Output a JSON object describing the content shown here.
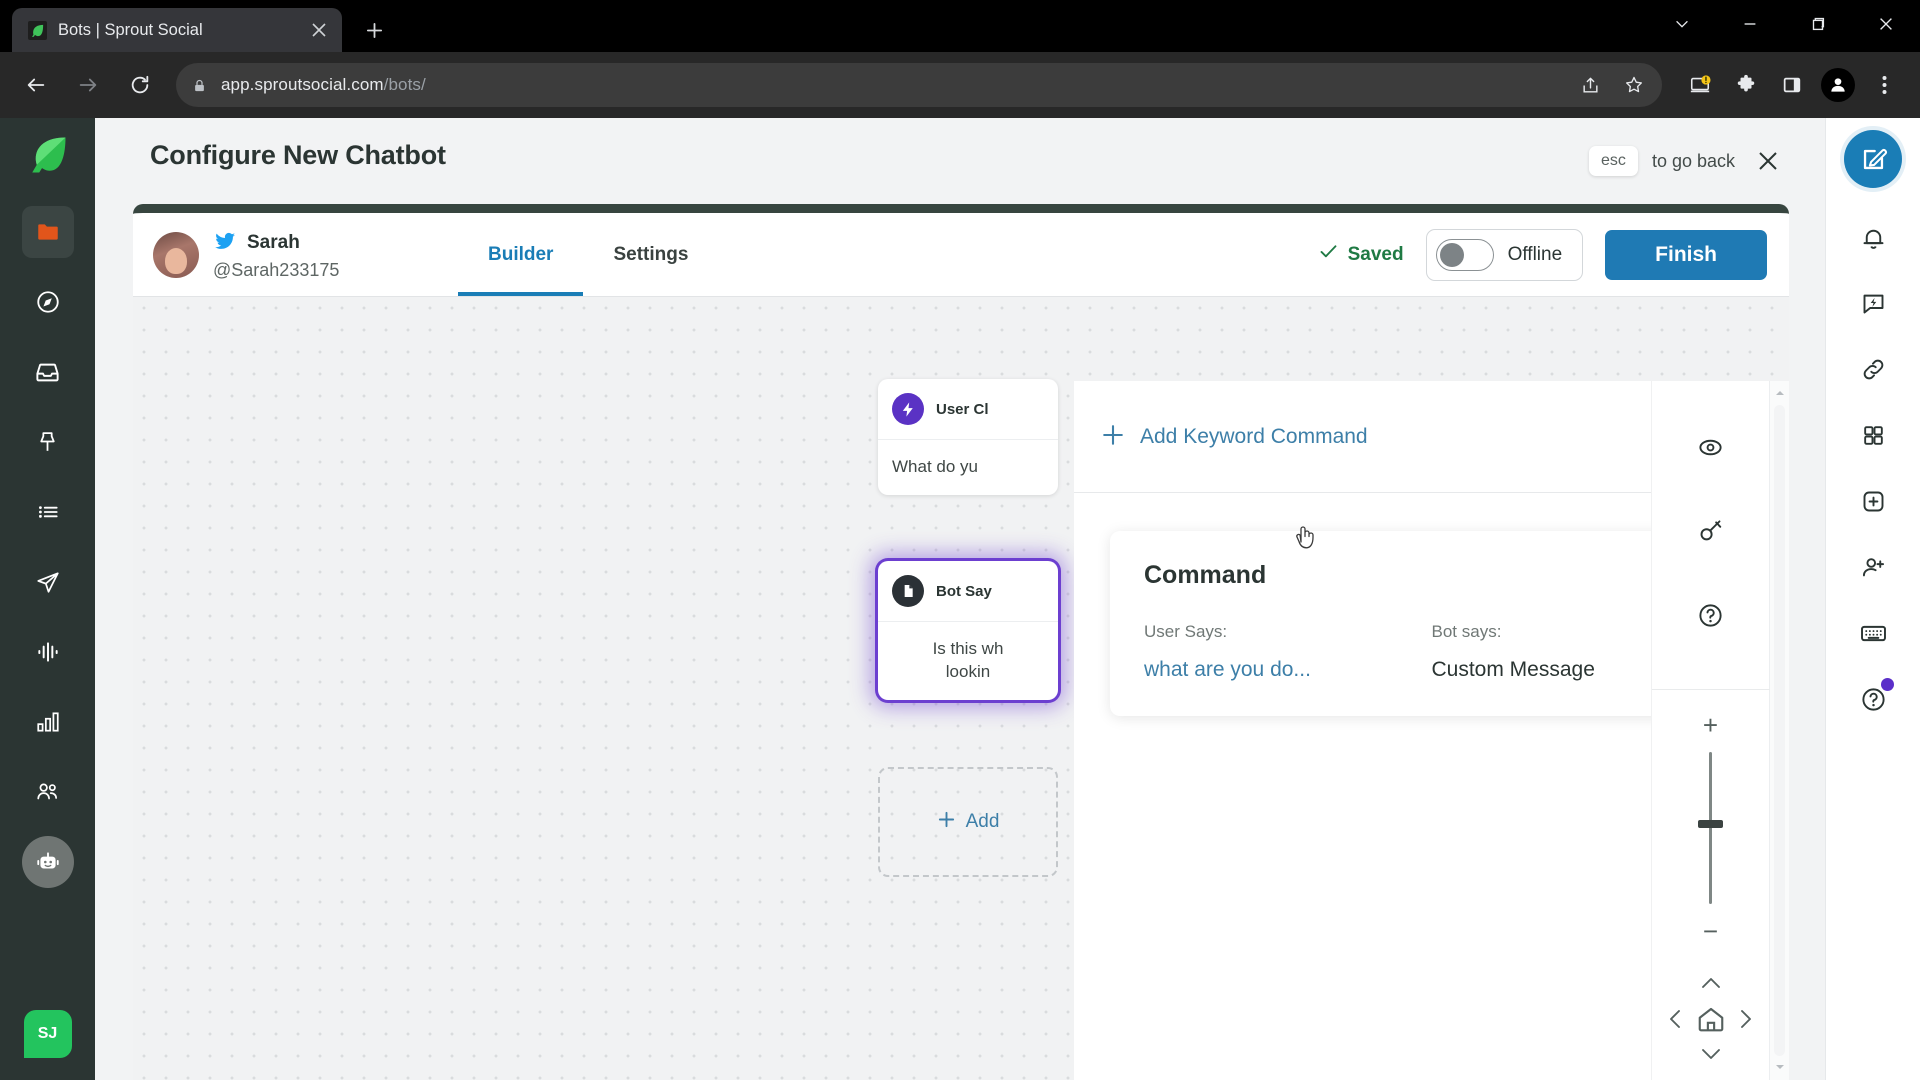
{
  "browser": {
    "tab": {
      "title": "Bots | Sprout Social",
      "favicon_icon": "sprout-leaf-icon",
      "close_icon": "close-icon"
    },
    "new_tab_icon": "plus-icon",
    "window_controls": [
      {
        "name": "chevron-down-icon",
        "glyph": "chevron-down"
      },
      {
        "name": "minimize-icon",
        "glyph": "minimize"
      },
      {
        "name": "maximize-icon",
        "glyph": "maximize"
      },
      {
        "name": "close-window-icon",
        "glyph": "close"
      }
    ],
    "nav": {
      "back_icon": "back-arrow-icon",
      "forward_icon": "forward-arrow-icon",
      "reload_icon": "reload-icon"
    },
    "omnibox": {
      "lock_icon": "lock-icon",
      "url_domain": "app.sproutsocial.com",
      "url_path": "/bots/",
      "share_icon": "share-icon",
      "bookmark_icon": "star-icon"
    },
    "toolbar_icons": [
      {
        "name": "device-warning-icon"
      },
      {
        "name": "extensions-puzzle-icon"
      },
      {
        "name": "side-panel-icon"
      },
      {
        "name": "profile-avatar-icon"
      },
      {
        "name": "browser-menu-icon"
      }
    ]
  },
  "left_rail": {
    "logo": "sprout-leaf-logo",
    "items": [
      {
        "name": "sidebar-item-folder",
        "icon": "folder-icon",
        "active": true
      },
      {
        "name": "sidebar-item-compass",
        "icon": "compass-icon"
      },
      {
        "name": "sidebar-item-inbox",
        "icon": "inbox-icon"
      },
      {
        "name": "sidebar-item-publishing",
        "icon": "pin-icon"
      },
      {
        "name": "sidebar-item-list",
        "icon": "list-icon"
      },
      {
        "name": "sidebar-item-send",
        "icon": "paper-plane-icon"
      },
      {
        "name": "sidebar-item-listening",
        "icon": "waveform-icon"
      },
      {
        "name": "sidebar-item-reports",
        "icon": "bar-chart-icon"
      },
      {
        "name": "sidebar-item-people",
        "icon": "people-icon"
      },
      {
        "name": "sidebar-item-bots",
        "icon": "bot-icon",
        "active": true
      }
    ],
    "user_initials": "SJ"
  },
  "header": {
    "title": "Configure New Chatbot",
    "esc_key": "esc",
    "esc_text": "to go back",
    "close_icon": "close-icon"
  },
  "card_header": {
    "profile": {
      "network_icon": "twitter-icon",
      "name": "Sarah",
      "handle": "@Sarah233175",
      "avatar": "avatar"
    },
    "tabs": [
      {
        "label": "Builder",
        "active": true
      },
      {
        "label": "Settings",
        "active": false
      }
    ],
    "saved_label": "Saved",
    "saved_icon": "check-icon",
    "toggle_label": "Offline",
    "toggle_state": "off",
    "finish_label": "Finish"
  },
  "canvas": {
    "nodes": [
      {
        "name": "user-clicks-node",
        "badge_icon": "lightning-bolt-icon",
        "badge_color": "#5a32c4",
        "title": "User Cl",
        "body": "What do yu",
        "selected": false
      },
      {
        "name": "bot-says-node",
        "badge_icon": "document-icon",
        "badge_color": "#2b3136",
        "title": "Bot Say",
        "body": "Is this wh\nlookin",
        "selected": true
      }
    ],
    "add_node_label": "Add",
    "add_node_icon": "plus-icon"
  },
  "drawer": {
    "add_keyword_label": "Add Keyword Command",
    "add_keyword_icon": "plus-icon",
    "command": {
      "title": "Command",
      "edit_icon": "pencil-icon",
      "user_says_label": "User Says:",
      "user_says_value": "what are you do...",
      "bot_says_label": "Bot says:",
      "bot_says_value": "Custom Message"
    }
  },
  "tool_column": {
    "icons": [
      {
        "name": "preview-eye-icon"
      },
      {
        "name": "key-icon"
      },
      {
        "name": "help-circle-icon"
      }
    ],
    "zoom_in": "+",
    "zoom_out": "−",
    "dpad": {
      "up_icon": "chevron-up-icon",
      "left_icon": "chevron-left-icon",
      "home_icon": "home-icon",
      "right_icon": "chevron-right-icon",
      "down_icon": "chevron-down-icon"
    }
  },
  "right_rail": {
    "compose_icon": "compose-icon",
    "items": [
      {
        "name": "notifications-bell-icon"
      },
      {
        "name": "chat-lightning-icon"
      },
      {
        "name": "link-icon"
      },
      {
        "name": "grid-apps-icon"
      },
      {
        "name": "add-square-icon"
      },
      {
        "name": "add-person-icon"
      },
      {
        "name": "keyboard-icon"
      },
      {
        "name": "help-circle-icon",
        "has_badge": true
      }
    ]
  },
  "colors": {
    "brand_green": "#23c45e",
    "rail_dark": "#2b3533",
    "accent_blue": "#1f7ab4",
    "node_purple": "#5a32c4",
    "saved_green": "#1f7a44"
  }
}
